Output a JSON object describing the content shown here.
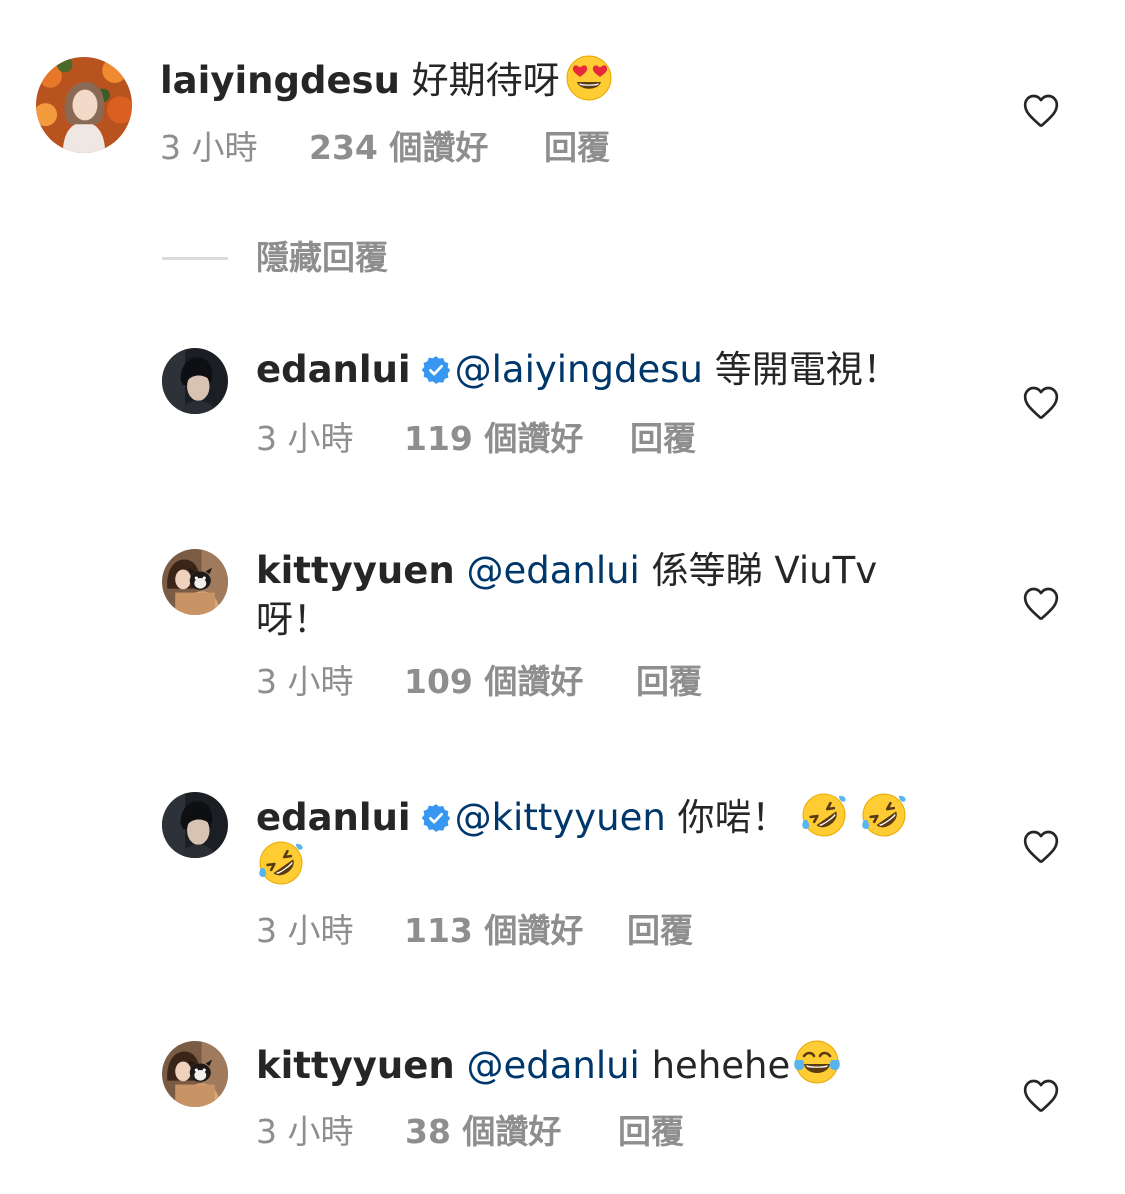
{
  "comments": [
    {
      "username": "laiyingdesu",
      "verified": false,
      "mention": "",
      "line1": " 好期待呀",
      "line2": "",
      "time": "3 小時",
      "likes": "234 個讚好",
      "reply": "回覆",
      "avatar_icon": "avatar-woman-orange-flowers",
      "emoji": "smiling-face-with-heart-eyes"
    },
    {
      "username": "edanlui",
      "verified": true,
      "mention": "@laiyingdesu",
      "line1": " 等開電視！",
      "line2": "",
      "time": "3 小時",
      "likes": "119 個讚好",
      "reply": "回覆",
      "avatar_icon": "avatar-man-dark-portrait"
    },
    {
      "username": "kittyyuen",
      "verified": false,
      "mention": "@edanlui",
      "line1": " 係等睇 ViuTv",
      "line2": "呀！",
      "time": "3 小時",
      "likes": "109 個讚好",
      "reply": "回覆",
      "avatar_icon": "avatar-woman-with-dog"
    },
    {
      "username": "edanlui",
      "verified": true,
      "mention": "@kittyyuen",
      "line1": " 你啱！",
      "line2": "",
      "time": "3 小時",
      "likes": "113 個讚好",
      "reply": "回覆",
      "avatar_icon": "avatar-man-dark-portrait",
      "emoji": "rolling-on-the-floor-laughing"
    },
    {
      "username": "kittyyuen",
      "verified": false,
      "mention": "@edanlui",
      "line1": " hehehe",
      "line2": "",
      "time": "3 小時",
      "likes": "38 個讚好",
      "reply": "回覆",
      "avatar_icon": "avatar-woman-with-dog",
      "emoji": "face-with-tears-of-joy"
    }
  ],
  "hide_replies_label": "隱藏回覆",
  "icons": {
    "like": "heart-outline-icon",
    "verified": "verified-badge-icon"
  },
  "colors": {
    "text": "#262626",
    "secondary": "#8e8e8e",
    "mention": "#00376b",
    "verified": "#3897f0"
  }
}
